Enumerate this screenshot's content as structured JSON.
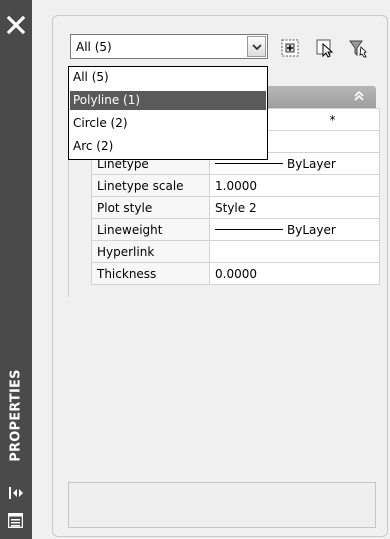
{
  "palette": {
    "titlebar": "#4a4a4a",
    "selection": "#5a5a5a",
    "header": "#a8a8a8"
  },
  "titlebar": {
    "title": "PROPERTIES",
    "close_icon": "close-icon",
    "collapse_icon": "collapse-arrows-icon",
    "menu_icon": "properties-menu-icon"
  },
  "selector": {
    "value": "All (5)",
    "options": [
      {
        "label": "All (5)"
      },
      {
        "label": "Polyline (1)",
        "selected": true
      },
      {
        "label": "Circle (2)"
      },
      {
        "label": "Arc (2)"
      }
    ]
  },
  "toolbar": [
    {
      "name": "toggle-pickadd-button",
      "icon": "pickadd-icon"
    },
    {
      "name": "select-objects-button",
      "icon": "select-objects-icon"
    },
    {
      "name": "quick-select-button",
      "icon": "quick-select-filter-icon"
    }
  ],
  "section": {
    "chevron_icon": "collapse-up-chevrons-icon",
    "peek_text": "*"
  },
  "properties": [
    {
      "name": "Linetype",
      "value": "ByLayer",
      "line": true
    },
    {
      "name": "Linetype scale",
      "value": "1.0000"
    },
    {
      "name": "Plot style",
      "value": "Style 2"
    },
    {
      "name": "Lineweight",
      "value": "ByLayer",
      "line": true
    },
    {
      "name": "Hyperlink",
      "value": ""
    },
    {
      "name": "Thickness",
      "value": "0.0000"
    }
  ],
  "description": ""
}
